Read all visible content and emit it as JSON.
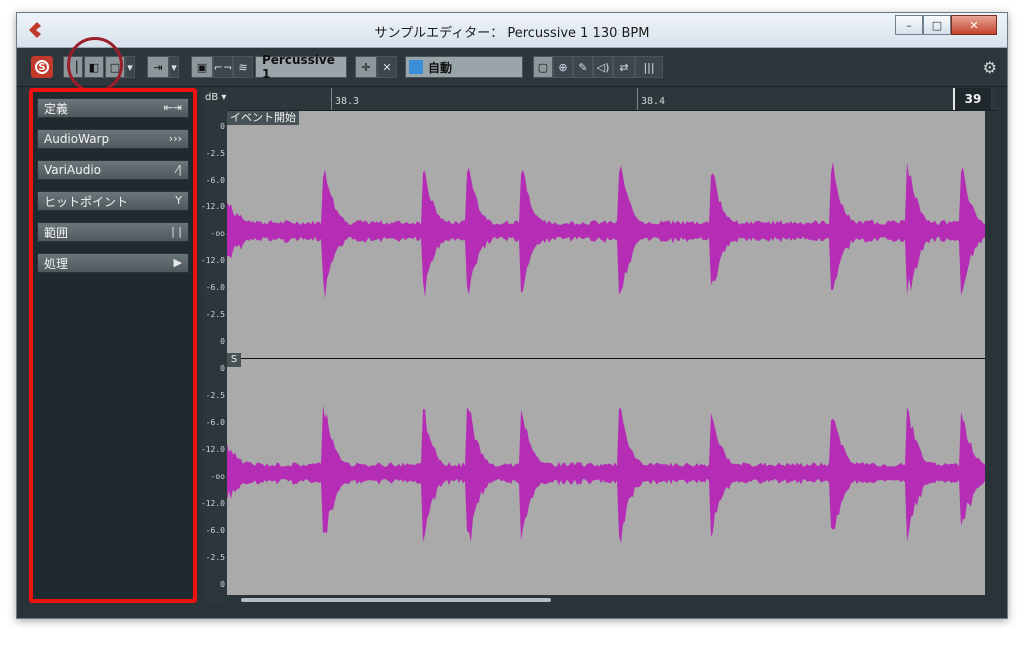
{
  "window": {
    "title": "サンプルエディター： Percussive 1 130 BPM",
    "buttons": {
      "minimize": "–",
      "maximize": "□",
      "close": "✕"
    }
  },
  "toolbar": {
    "solo_label": "S",
    "clip_selector": "Percussive 1",
    "colorize_selector": "自動",
    "icons": [
      "solo-icon",
      "left-zone-icon",
      "right-zone-icon",
      "chevron-down-icon",
      "play-audio-icon",
      "loop-icon",
      "snap-icon",
      "snap-zero-icon",
      "grid-icon",
      "crosshair-icon",
      "collapse-icon",
      "color-icon",
      "select-icon",
      "zoom-icon",
      "pencil-icon",
      "speaker-icon",
      "time-warp-icon",
      "bars-icon",
      "gear-icon"
    ]
  },
  "sidebar": {
    "items": [
      {
        "label": "定義",
        "icon": "⇤⇥"
      },
      {
        "label": "AudioWarp",
        "icon": "›››"
      },
      {
        "label": "VariAudio",
        "icon": "⁄|"
      },
      {
        "label": "ヒットポイント",
        "icon": "Y"
      },
      {
        "label": "範囲",
        "icon": "| |"
      },
      {
        "label": "処理",
        "icon": "▶"
      }
    ]
  },
  "ruler": {
    "labels": [
      "38.3",
      "38.4"
    ],
    "end_bar": "39"
  },
  "db_axis": {
    "header": "dB ▾",
    "top_channel": [
      "0",
      "-2.5",
      "-6.0",
      "-12.0",
      "-oo",
      "-12.0",
      "-6.0",
      "-2.5",
      "0"
    ],
    "bottom_channel": [
      "0",
      "-2.5",
      "-6.0",
      "-12.0",
      "-oo",
      "-12.0",
      "-6.0",
      "-2.5",
      "0"
    ]
  },
  "waveform": {
    "event_start_label": "イベント開始",
    "channel_label": "S",
    "color": "#b52db5",
    "background": "#aaaaaa"
  },
  "colors": {
    "highlight_red": "#ee1111",
    "circle_red": "#9a1f2b"
  }
}
